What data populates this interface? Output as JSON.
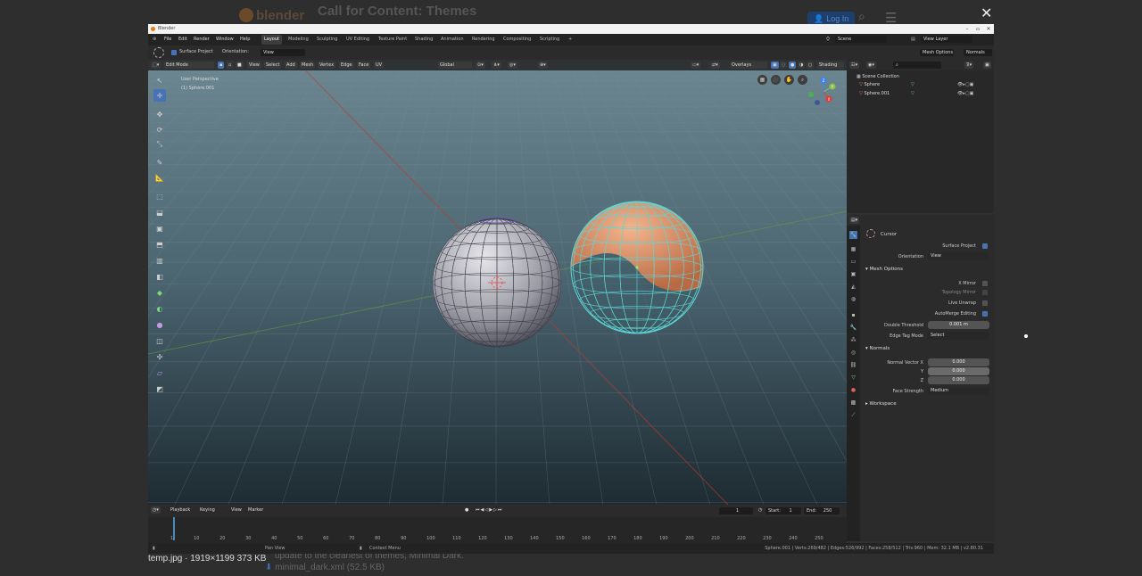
{
  "background_page": {
    "logo_text": "blender",
    "title": "Call for Content: Themes",
    "login_label": "Log In",
    "text_1": "update to the cleanest of themes, Minimal Dark.",
    "text_2": "minimal_dark.xml",
    "text_2_size": "(52.5 KB)",
    "close_glyph": "✕"
  },
  "caption": "temp.jpg · 1919×1199 373 KB",
  "window": {
    "title": "Blender",
    "menus": [
      "File",
      "Edit",
      "Render",
      "Window",
      "Help"
    ],
    "workspace_tabs": [
      "Layout",
      "Modeling",
      "Sculpting",
      "UV Editing",
      "Texture Paint",
      "Shading",
      "Animation",
      "Rendering",
      "Compositing",
      "Scripting"
    ],
    "active_workspace": "Layout",
    "scene": "Scene",
    "view_layer": "View Layer"
  },
  "tool_settings": {
    "surface_project_label": "Surface Project",
    "orientation_label": "Orientation:",
    "orientation_value": "View",
    "mesh_options": "Mesh Options",
    "normals": "Normals"
  },
  "viewport": {
    "mode": "Edit Mode",
    "menus": [
      "View",
      "Select",
      "Add",
      "Mesh",
      "Vertex",
      "Edge",
      "Face",
      "UV"
    ],
    "transform_orientation": "Global",
    "overlays": "Overlays",
    "shading": "Shading",
    "info_line1": "User Perspective",
    "info_line2": "(1) Sphere.001",
    "gizmo_axes": [
      "X",
      "Y",
      "Z"
    ]
  },
  "outliner": {
    "collection": "Scene Collection",
    "objects": [
      "Sphere",
      "Sphere.001"
    ]
  },
  "properties": {
    "tool_name": "Cursor",
    "surface_project": "Surface Project",
    "orientation_label": "Orientation",
    "orientation_value": "View",
    "mesh_options_title": "Mesh Options",
    "x_mirror": "X Mirror",
    "topology_mirror": "Topology Mirror",
    "live_unwrap": "Live Unwrap",
    "automerge": "AutoMerge Editing",
    "double_threshold_label": "Double Threshold",
    "double_threshold_value": "0.001 m",
    "edge_tag_label": "Edge Tag Mode",
    "edge_tag_value": "Select",
    "normals_title": "Normals",
    "normal_vector_label": "Normal Vector X",
    "normal_y_label": "Y",
    "normal_z_label": "Z",
    "normal_x_value": "0.000",
    "normal_y_value": "0.000",
    "normal_z_value": "0.000",
    "face_strength_label": "Face Strength",
    "face_strength_value": "Medium",
    "workspace_title": "Workspace",
    "checks": {
      "surface_project": true,
      "x_mirror": false,
      "topology_mirror": false,
      "live_unwrap": false,
      "automerge": true
    }
  },
  "timeline": {
    "menus": [
      "Playback",
      "Keying",
      "View",
      "Marker"
    ],
    "current_frame": "1",
    "start_label": "Start:",
    "start": "1",
    "end_label": "End:",
    "end": "250",
    "ruler": [
      "1",
      "10",
      "20",
      "30",
      "40",
      "50",
      "60",
      "70",
      "80",
      "90",
      "100",
      "110",
      "120",
      "130",
      "140",
      "150",
      "160",
      "170",
      "180",
      "190",
      "200",
      "210",
      "220",
      "230",
      "240",
      "250"
    ]
  },
  "statusbar": {
    "pan_view": "Pan View",
    "context_menu": "Context Menu",
    "stats": "Sphere.001 | Verts:269/482 | Edges:526/992 | Faces:258/512 | Tris:960 | Mem: 32.1 MB | v2.80.31"
  },
  "colors": {
    "accent": "#4772b3",
    "selected_mesh": "#e8956a",
    "wire_selected": "#5fd6d6",
    "grid_bg_top": "#6e8894",
    "grid_bg_bottom": "#223038"
  }
}
